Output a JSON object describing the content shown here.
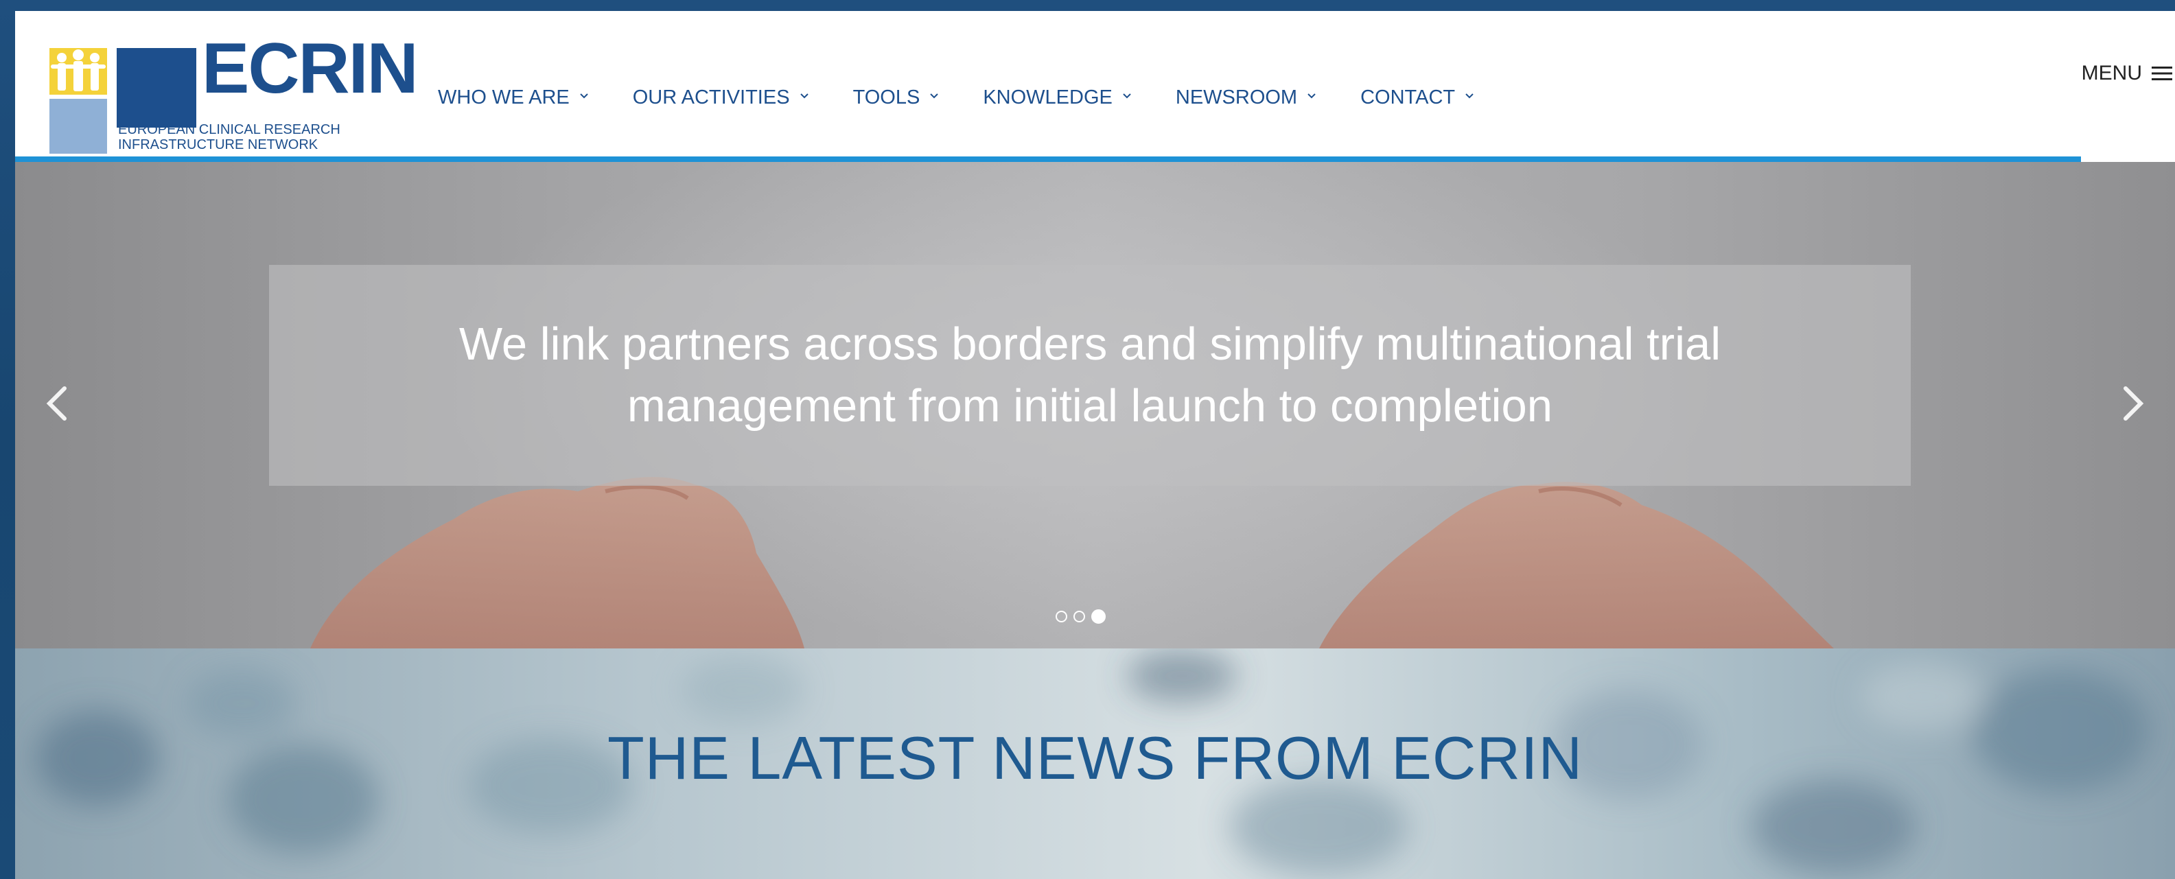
{
  "brand": {
    "name": "ECRIN",
    "tagline_line1": "EUROPEAN CLINICAL RESEARCH",
    "tagline_line2": "INFRASTRUCTURE NETWORK",
    "colors": {
      "primary": "#1d4f8d",
      "accent": "#1e92d6",
      "logo_light": "#8fb0d6",
      "logo_yellow": "#f2c81a"
    }
  },
  "nav": {
    "items": [
      {
        "label": "WHO WE ARE"
      },
      {
        "label": "OUR ACTIVITIES"
      },
      {
        "label": "TOOLS"
      },
      {
        "label": "KNOWLEDGE"
      },
      {
        "label": "NEWSROOM"
      },
      {
        "label": "CONTACT"
      }
    ],
    "menu_label": "MENU"
  },
  "hero": {
    "caption": "We link partners across borders and simplify multinational trial management from initial launch to completion",
    "slides_total": 3,
    "active_slide": 3
  },
  "news": {
    "title": "THE LATEST NEWS FROM ECRIN"
  }
}
